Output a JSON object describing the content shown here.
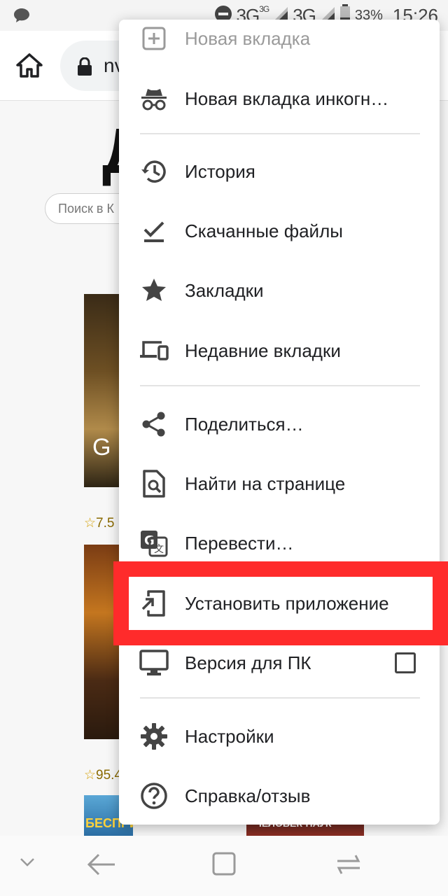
{
  "status_bar": {
    "network_1": "3G",
    "network_1_sup": "3G",
    "network_2": "3G",
    "battery": "33%",
    "time": "15:26"
  },
  "toolbar": {
    "url_partial": "nv"
  },
  "page": {
    "heading": "Д",
    "search_placeholder": "Поиск в К",
    "poster_1_letter": "G",
    "rating_1": "7.5",
    "rating_2": "95.4",
    "poster_3_title": "БЕСПРИНЦИПНЫЕ",
    "poster_4_title": "ЧЕЛОВЕК-ПАУК"
  },
  "menu": {
    "items": [
      {
        "label": "Новая вкладка",
        "icon": "new-tab-icon"
      },
      {
        "label": "Новая вкладка инкогн…",
        "icon": "incognito-icon"
      },
      {
        "label": "История",
        "icon": "history-icon"
      },
      {
        "label": "Скачанные файлы",
        "icon": "download-done-icon"
      },
      {
        "label": "Закладки",
        "icon": "star-icon"
      },
      {
        "label": "Недавние вкладки",
        "icon": "devices-icon"
      },
      {
        "label": "Поделиться…",
        "icon": "share-icon"
      },
      {
        "label": "Найти на странице",
        "icon": "find-in-page-icon"
      },
      {
        "label": "Перевести…",
        "icon": "translate-icon"
      },
      {
        "label": "Установить приложение",
        "icon": "install-app-icon"
      },
      {
        "label": "Версия для ПК",
        "icon": "desktop-icon",
        "checked": false
      },
      {
        "label": "Настройки",
        "icon": "settings-gear-icon"
      },
      {
        "label": "Справка/отзыв",
        "icon": "help-icon"
      }
    ]
  },
  "colors": {
    "highlight": "#ff2b2b",
    "icon": "#444444"
  }
}
